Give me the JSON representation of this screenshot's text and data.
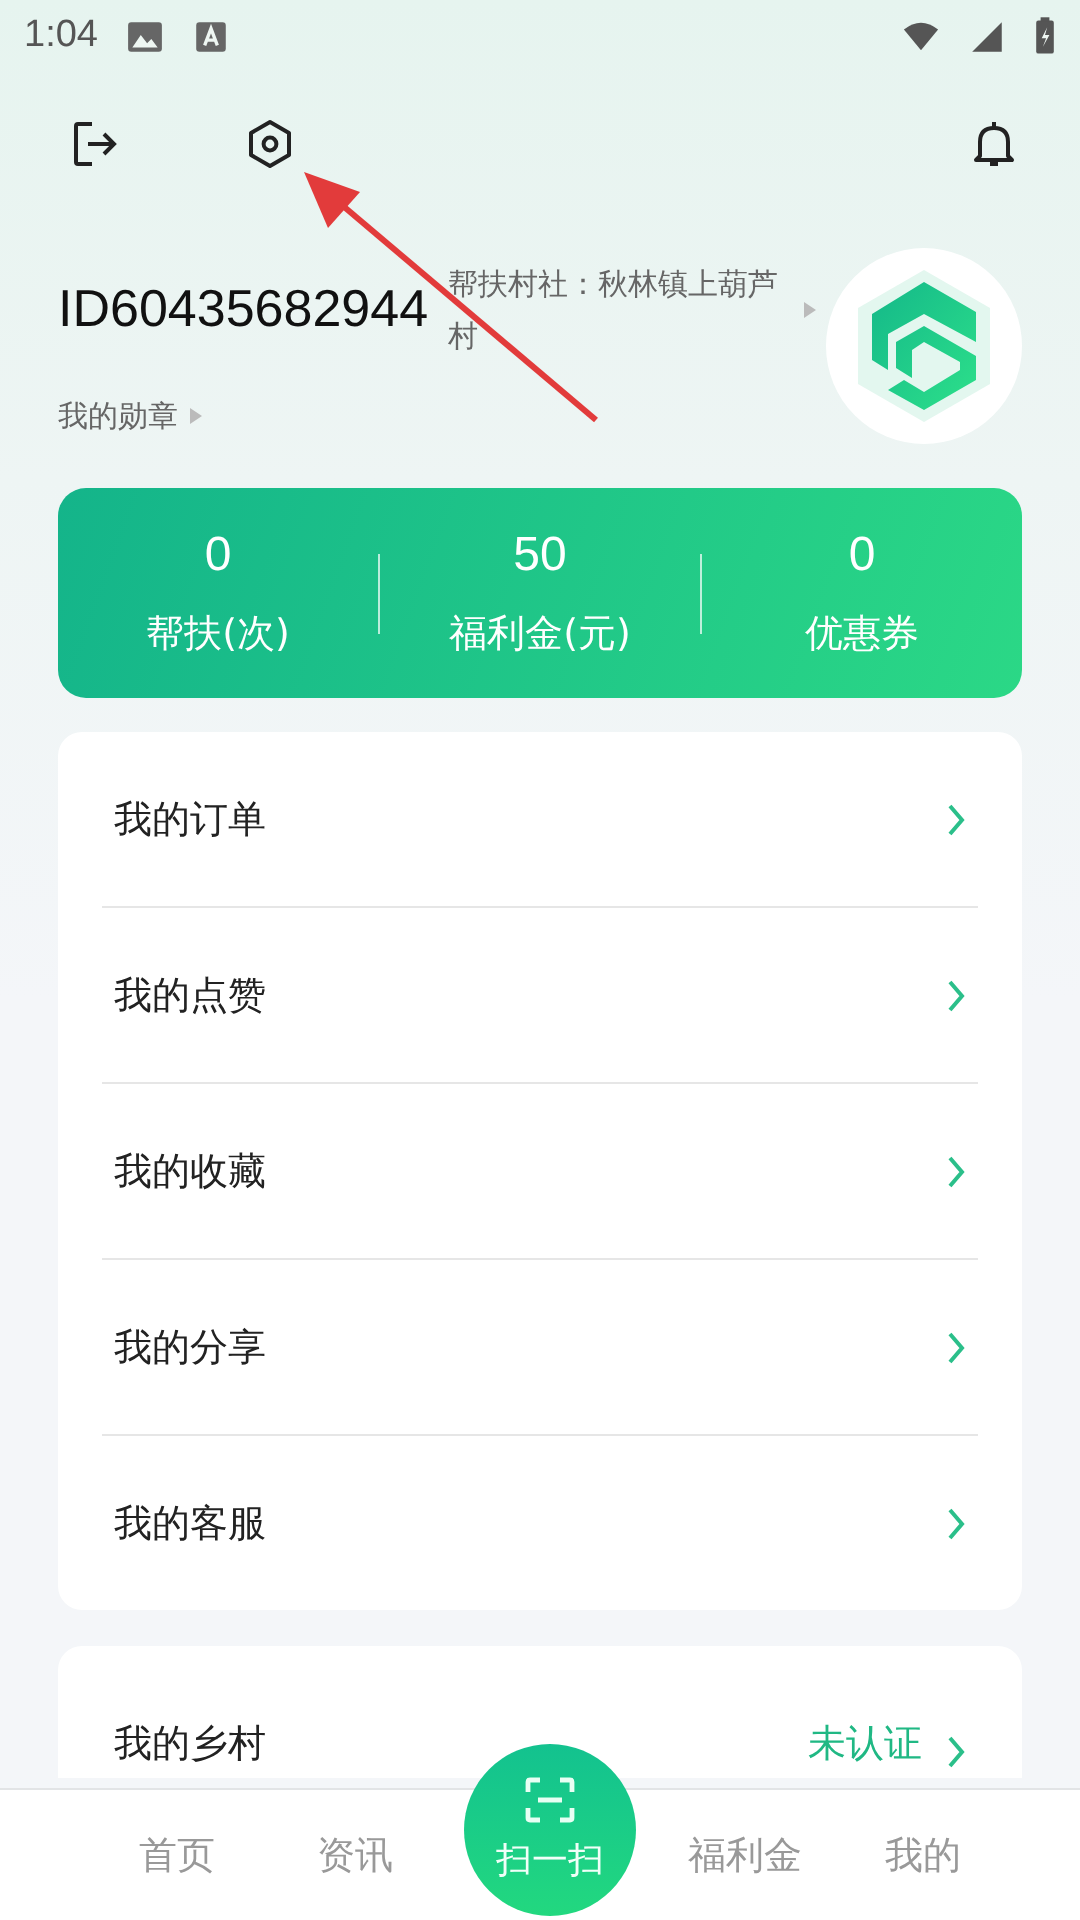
{
  "status_bar": {
    "time": "1:04"
  },
  "profile": {
    "user_id": "ID60435682944",
    "village_label": "帮扶村社：秋林镇上葫芦村",
    "medals_link": "我的勋章"
  },
  "stats": [
    {
      "value": "0",
      "label": "帮扶(次)"
    },
    {
      "value": "50",
      "label": "福利金(元)"
    },
    {
      "value": "0",
      "label": "优惠券"
    }
  ],
  "menu": [
    {
      "label": "我的订单"
    },
    {
      "label": "我的点赞"
    },
    {
      "label": "我的收藏"
    },
    {
      "label": "我的分享"
    },
    {
      "label": "我的客服"
    }
  ],
  "village_row": {
    "label": "我的乡村",
    "status": "未认证"
  },
  "bottom_nav": {
    "items": [
      {
        "label": "首页"
      },
      {
        "label": "资讯"
      },
      {
        "label": "福利金"
      },
      {
        "label": "我的"
      }
    ],
    "scan_button": "扫一扫"
  }
}
